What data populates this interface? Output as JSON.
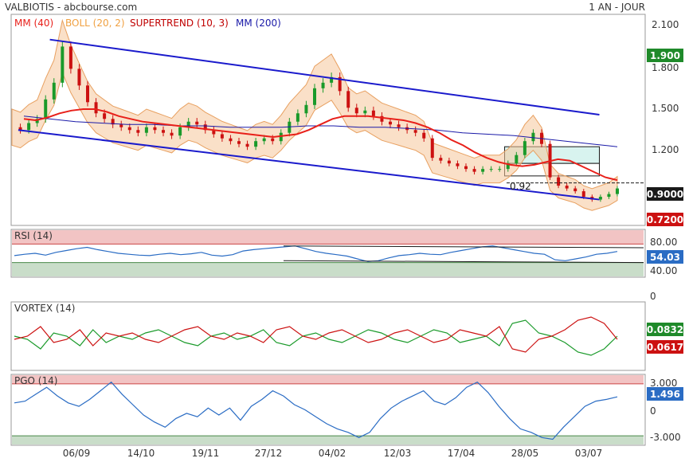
{
  "header": {
    "title": "VALBIOTIS - abcbourse.com",
    "period": "1 AN - JOUR"
  },
  "chart_data": [
    {
      "type": "line",
      "panel": "price",
      "legend": [
        {
          "label": "MM (40)",
          "color": "#e8201a"
        },
        {
          "label": "BOLL (20, 2)",
          "color": "#f0a040"
        },
        {
          "label": "SUPERTREND (10, 3)",
          "color": "#c00000"
        },
        {
          "label": "MM (200)",
          "color": "#1a1aa8"
        }
      ],
      "y_ticks": [
        "2.100",
        "1.800",
        "1.500",
        "1.200",
        "0.9000"
      ],
      "ylim": [
        0.6,
        2.1
      ],
      "x_ticks": [
        "06/09",
        "14/10",
        "19/11",
        "27/12",
        "04/02",
        "12/03",
        "17/04",
        "28/05",
        "03/07"
      ],
      "badges": [
        {
          "label": "1.900",
          "value": 1.9,
          "color": "#1f8a2a"
        },
        {
          "label": "0.9000",
          "value": 0.9,
          "color": "#1a1a1a"
        },
        {
          "label": "0.7200",
          "value": 0.72,
          "color": "#cc1111"
        }
      ],
      "annotation": "0.92",
      "close": [
        1.3,
        1.28,
        1.33,
        1.36,
        1.5,
        1.62,
        1.88,
        1.72,
        1.6,
        1.48,
        1.4,
        1.36,
        1.32,
        1.3,
        1.28,
        1.26,
        1.3,
        1.28,
        1.26,
        1.24,
        1.3,
        1.34,
        1.32,
        1.28,
        1.25,
        1.22,
        1.2,
        1.18,
        1.16,
        1.2,
        1.22,
        1.2,
        1.26,
        1.34,
        1.4,
        1.46,
        1.58,
        1.62,
        1.66,
        1.56,
        1.44,
        1.4,
        1.42,
        1.38,
        1.34,
        1.32,
        1.3,
        1.28,
        1.26,
        1.22,
        1.08,
        1.06,
        1.04,
        1.02,
        1.0,
        0.98,
        1.0,
        1.0,
        1.0,
        1.04,
        1.1,
        1.2,
        1.26,
        1.18,
        0.94,
        0.88,
        0.86,
        0.84,
        0.8,
        0.78,
        0.8,
        0.82,
        0.86
      ],
      "ma40": [
        1.36,
        1.35,
        1.37,
        1.4,
        1.42,
        1.43,
        1.43,
        1.41,
        1.38,
        1.36,
        1.34,
        1.33,
        1.32,
        1.31,
        1.3,
        1.29,
        1.28,
        1.27,
        1.26,
        1.25,
        1.24,
        1.23,
        1.24,
        1.25,
        1.28,
        1.32,
        1.36,
        1.38,
        1.38,
        1.38,
        1.37,
        1.36,
        1.35,
        1.33,
        1.3,
        1.26,
        1.21,
        1.17,
        1.12,
        1.08,
        1.05,
        1.03,
        1.02,
        1.03,
        1.05,
        1.07,
        1.06,
        1.02,
        0.98,
        0.94,
        0.92
      ],
      "ma200": [
        1.38,
        1.36,
        1.34,
        1.33,
        1.32,
        1.32,
        1.31,
        1.31,
        1.3,
        1.3,
        1.3,
        1.31,
        1.31,
        1.3,
        1.3,
        1.29,
        1.28,
        1.26,
        1.25,
        1.24,
        1.22,
        1.2,
        1.18,
        1.16
      ],
      "channel": {
        "upper": [
          [
            0.06,
            1.93
          ],
          [
            0.93,
            1.39
          ]
        ],
        "lower": [
          [
            0.01,
            1.28
          ],
          [
            0.93,
            0.78
          ]
        ]
      },
      "zones": [
        {
          "x0": 0.78,
          "x1": 0.93,
          "y0": 1.04,
          "y1": 1.16,
          "fill": "#d8f3ef"
        },
        {
          "x0": 0.78,
          "x1": 0.93,
          "y0": 0.95,
          "y1": 1.04,
          "fill": "#ffffff"
        }
      ]
    },
    {
      "type": "line",
      "panel": "rsi",
      "title": "RSI (14)",
      "y_ticks": [
        "80.00",
        "40.00",
        "0"
      ],
      "ylim": [
        0,
        100
      ],
      "bands": [
        70,
        30
      ],
      "badge": {
        "label": "54.03",
        "value": 54.03,
        "color": "#2a6cc4"
      },
      "values": [
        45,
        48,
        50,
        46,
        52,
        56,
        60,
        63,
        58,
        54,
        50,
        48,
        46,
        45,
        48,
        50,
        47,
        49,
        52,
        46,
        44,
        47,
        55,
        58,
        60,
        62,
        64,
        66,
        60,
        54,
        50,
        47,
        44,
        38,
        32,
        34,
        40,
        45,
        47,
        50,
        48,
        47,
        52,
        56,
        60,
        64,
        66,
        62,
        58,
        54,
        50,
        48,
        36,
        34,
        38,
        42,
        48,
        50,
        54
      ],
      "trend_lines": [
        {
          "from": [
            0.43,
            66
          ],
          "to": [
            1.0,
            62
          ]
        },
        {
          "from": [
            0.43,
            34
          ],
          "to": [
            1.0,
            30
          ]
        }
      ]
    },
    {
      "type": "line",
      "panel": "vortex",
      "title": "VORTEX (14)",
      "badges": [
        {
          "label": "0.0832",
          "value": 0.0832,
          "color": "#1f8a2a"
        },
        {
          "label": "0.0617",
          "value": 0.0617,
          "color": "#cc1111"
        }
      ],
      "series": [
        {
          "color": "#1a9a2a",
          "values": [
            0.5,
            0.45,
            0.3,
            0.55,
            0.5,
            0.35,
            0.6,
            0.4,
            0.5,
            0.45,
            0.55,
            0.6,
            0.5,
            0.4,
            0.35,
            0.5,
            0.55,
            0.45,
            0.5,
            0.6,
            0.4,
            0.35,
            0.5,
            0.55,
            0.45,
            0.4,
            0.5,
            0.6,
            0.55,
            0.45,
            0.4,
            0.5,
            0.6,
            0.55,
            0.4,
            0.45,
            0.5,
            0.35,
            0.7,
            0.75,
            0.55,
            0.5,
            0.4,
            0.25,
            0.2,
            0.3,
            0.5
          ]
        },
        {
          "color": "#cc1111",
          "values": [
            0.45,
            0.5,
            0.65,
            0.4,
            0.45,
            0.6,
            0.35,
            0.55,
            0.5,
            0.55,
            0.45,
            0.4,
            0.5,
            0.6,
            0.65,
            0.5,
            0.45,
            0.55,
            0.5,
            0.4,
            0.6,
            0.65,
            0.5,
            0.45,
            0.55,
            0.6,
            0.5,
            0.4,
            0.45,
            0.55,
            0.6,
            0.5,
            0.4,
            0.45,
            0.6,
            0.55,
            0.5,
            0.65,
            0.3,
            0.25,
            0.45,
            0.5,
            0.6,
            0.75,
            0.8,
            0.7,
            0.45
          ]
        }
      ]
    },
    {
      "type": "line",
      "panel": "pgo",
      "title": "PGO (14)",
      "y_ticks": [
        "3.000",
        "0",
        "-3.000"
      ],
      "ylim": [
        -4,
        4
      ],
      "bands": [
        3,
        -3
      ],
      "badge": {
        "label": "1.496",
        "value": 1.496,
        "color": "#2a6cc4"
      },
      "values": [
        0.8,
        1.0,
        1.8,
        2.6,
        1.6,
        0.8,
        0.4,
        1.2,
        2.2,
        3.2,
        1.8,
        0.6,
        -0.6,
        -1.4,
        -2.0,
        -1.0,
        -0.4,
        -0.8,
        0.2,
        -0.6,
        0.2,
        -1.2,
        0.4,
        1.2,
        2.2,
        1.6,
        0.6,
        0.0,
        -0.8,
        -1.6,
        -2.2,
        -2.6,
        -3.2,
        -2.6,
        -1.0,
        0.2,
        1.0,
        1.6,
        2.2,
        1.0,
        0.6,
        1.4,
        2.6,
        3.2,
        2.0,
        0.4,
        -1.0,
        -2.2,
        -2.6,
        -3.2,
        -3.4,
        -2.0,
        -0.8,
        0.4,
        1.0,
        1.2,
        1.5
      ]
    }
  ]
}
